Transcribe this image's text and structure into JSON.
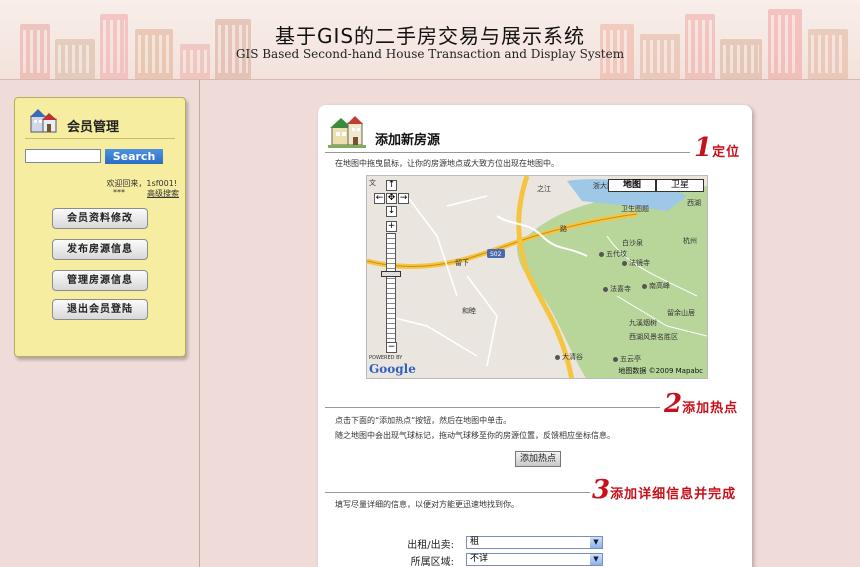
{
  "header": {
    "title": "基于GIS的二手房交易与展示系统",
    "subtitle": "GIS Based Second-hand House Transaction and Display System"
  },
  "member_panel": {
    "title": "会员管理",
    "search_button": "Search",
    "search_placeholder": "",
    "welcome_text": "欢迎回来，1sf001!",
    "welcome_masked": "***",
    "advanced_search": "高级搜索",
    "buttons": [
      "会员资料修改",
      "发布房源信息",
      "管理房源信息",
      "退出会员登陆"
    ]
  },
  "content": {
    "title": "添加新房源",
    "step1": {
      "num": "1",
      "label": "定位",
      "instruction": "在地图中拖曳鼠标，让你的房源地点或大致方位出现在地图中。"
    },
    "step2": {
      "num": "2",
      "label": "添加热点",
      "instruction_1": "点击下面的“添加热点”按钮，然后在地图中单击。",
      "instruction_2": "随之地图中会出现气球标记，拖动气球移至你的房源位置，反馈相应坐标信息。",
      "button": "添加热点"
    },
    "step3": {
      "num": "3",
      "label": "添加详细信息并完成",
      "instruction": "填写尽量详细的信息，以便对方能更迅速地找到你。"
    },
    "form": [
      {
        "label": "出租/出卖:",
        "value": "租"
      },
      {
        "label": "所属区域:",
        "value": "不详"
      }
    ]
  },
  "map": {
    "type_buttons": [
      "地图",
      "卫星"
    ],
    "powered_by": "POWERED BY",
    "logo": "Google",
    "copyright": "地图数据 ©2009 Mapabc",
    "labels": [
      "浙大路",
      "西湖",
      "卫生图题",
      "白沙泉",
      "五代坟",
      "法镜寺",
      "法喜寺",
      "南高峰",
      "大清谷",
      "五云亭",
      "西湖风景名胜区",
      "九溪烟树",
      "留余山居",
      "杭州",
      "之江",
      "留下",
      "和睦",
      "路",
      "文"
    ],
    "road_shield": "S02"
  },
  "colors": {
    "accent_red": "#c8101a",
    "panel_yellow": "#f6eda0",
    "page_bg": "#efdcd8",
    "map_green": "#b8d59a"
  }
}
